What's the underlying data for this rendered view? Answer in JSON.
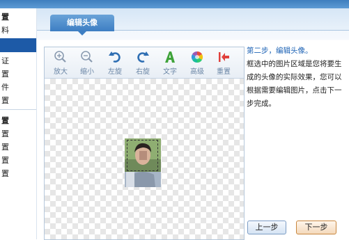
{
  "sidebar": {
    "items": [
      "置",
      "料",
      "证",
      "置",
      "件",
      "置",
      "置",
      "置",
      "置",
      "置",
      "置"
    ]
  },
  "tab": {
    "label": "编辑头像"
  },
  "toolbar": {
    "zoom_in": "放大",
    "zoom_out": "缩小",
    "rotate_left": "左旋",
    "rotate_right": "右旋",
    "text": "文字",
    "advanced": "高级",
    "reset": "重置"
  },
  "info": {
    "step_title": "第二步，编辑头像。",
    "description": "框选中的图片区域是您将要生成的头像的实际效果，您可以根据需要编辑图片，点击下一步完成。"
  },
  "buttons": {
    "prev": "上一步",
    "next": "下一步"
  },
  "colors": {
    "accent": "#1e63b5",
    "tab": "#3d7ec3",
    "next_border": "#c8863d"
  }
}
